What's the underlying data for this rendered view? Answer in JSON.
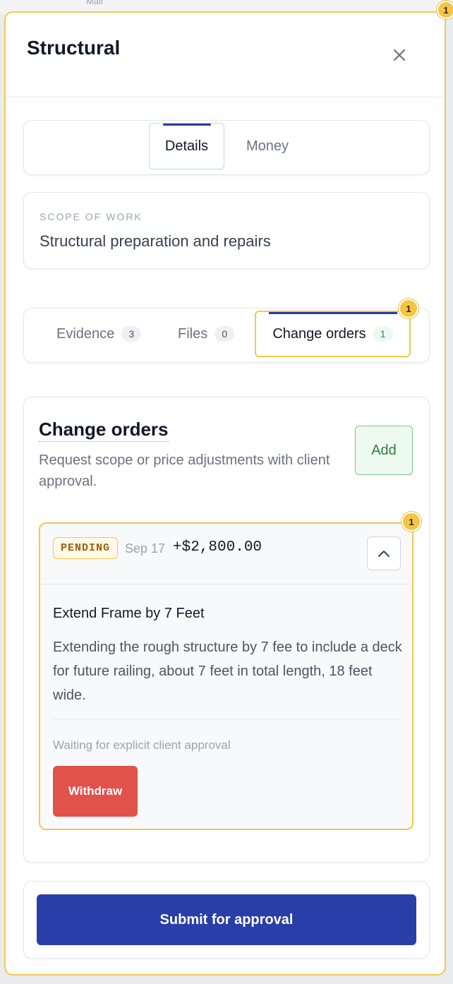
{
  "background": {
    "hint_text": "Mail"
  },
  "panel": {
    "notification_count": "1",
    "title": "Structural"
  },
  "top_tabs": [
    {
      "label": "Details",
      "active": true
    },
    {
      "label": "Money",
      "active": false
    }
  ],
  "scope": {
    "label": "SCOPE OF WORK",
    "value": "Structural preparation and repairs"
  },
  "sub_tabs": [
    {
      "label": "Evidence",
      "count": "3",
      "active": false
    },
    {
      "label": "Files",
      "count": "0",
      "active": false
    },
    {
      "label": "Change orders",
      "count": "1",
      "active": true,
      "badge": "1"
    }
  ],
  "change_orders": {
    "title": "Change orders",
    "description": "Request scope or price adjustments with client approval.",
    "add_label": "Add",
    "items": [
      {
        "badge": "1",
        "status": "PENDING",
        "date": "Sep 17",
        "amount": "+$2,800.00",
        "name": "Extend Frame by 7 Feet",
        "text": "Extending the rough structure by 7 fee to include a deck for future railing, about 7 feet in total length, 18 feet wide.",
        "waiting": "Waiting for explicit client approval",
        "withdraw_label": "Withdraw"
      }
    ]
  },
  "footer": {
    "submit_label": "Submit for approval"
  },
  "colors": {
    "accent": "#2a3ea9",
    "highlight": "#f2c94c",
    "danger": "#e0524a",
    "success": "#2f7d44"
  }
}
